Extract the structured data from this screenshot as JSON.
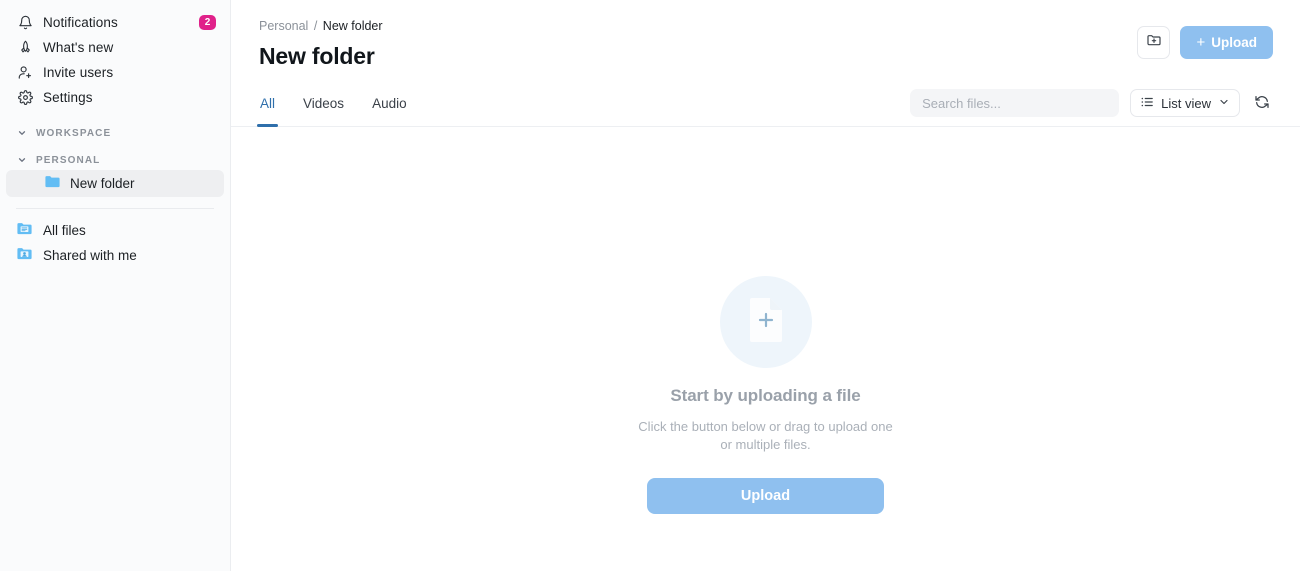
{
  "sidebar": {
    "nav_items": [
      {
        "label": "Notifications",
        "icon": "bell-icon",
        "badge": "2"
      },
      {
        "label": "What's new",
        "icon": "megaphone-icon",
        "badge": null
      },
      {
        "label": "Invite users",
        "icon": "user-plus-icon",
        "badge": null
      },
      {
        "label": "Settings",
        "icon": "gear-icon",
        "badge": null
      }
    ],
    "sections": [
      {
        "label": "WORKSPACE",
        "icon": "chevron-down-icon"
      },
      {
        "label": "PERSONAL",
        "icon": "chevron-down-icon"
      }
    ],
    "tree_items": [
      {
        "label": "New folder",
        "icon": "folder-icon",
        "selected": true
      }
    ],
    "file_items": [
      {
        "label": "All files",
        "icon": "folder-files-icon"
      },
      {
        "label": "Shared with me",
        "icon": "folder-shared-icon"
      }
    ]
  },
  "header": {
    "breadcrumb": {
      "parent": "Personal",
      "separator": "/",
      "current": "New folder"
    },
    "title": "New folder",
    "new_folder_icon": "folder-plus-icon",
    "upload_label": "Upload",
    "upload_plus": "+"
  },
  "tabs": [
    {
      "label": "All",
      "active": true
    },
    {
      "label": "Videos",
      "active": false
    },
    {
      "label": "Audio",
      "active": false
    }
  ],
  "controls": {
    "search_placeholder": "Search files...",
    "search_value": "",
    "view_label": "List view",
    "view_icon": "list-icon",
    "view_chevron": "chevron-down-icon",
    "refresh_icon": "refresh-icon"
  },
  "empty_state": {
    "icon": "file-plus-icon",
    "title": "Start by uploading a file",
    "subtitle": "Click the button below or drag to upload one or multiple files.",
    "button_label": "Upload"
  },
  "colors": {
    "accent_blue": "#2f6fab",
    "button_blue": "#8fc0ef",
    "badge_pink": "#e0218a",
    "folder_blue": "#62bdf4",
    "sidebar_bg": "#fafbfc"
  }
}
